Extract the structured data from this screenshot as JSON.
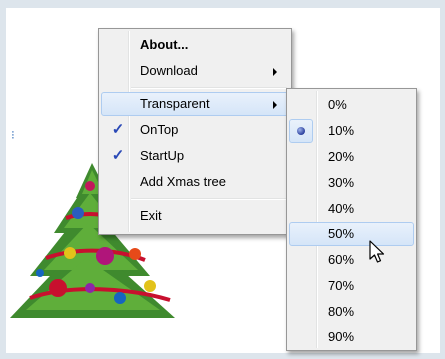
{
  "main_menu": {
    "items": [
      {
        "label": "About...",
        "bold": true
      },
      {
        "label": "Download",
        "submenu": true
      },
      {
        "label": "Transparent",
        "submenu": true,
        "highlighted": true
      },
      {
        "label": "OnTop",
        "checked": true
      },
      {
        "label": "StartUp",
        "checked": true
      },
      {
        "label": "Add Xmas tree"
      },
      {
        "label": "Exit"
      }
    ],
    "check_glyph": "✓"
  },
  "transparency_menu": {
    "items": [
      "0%",
      "10%",
      "20%",
      "30%",
      "40%",
      "50%",
      "60%",
      "70%",
      "80%",
      "90%"
    ],
    "selected": "10%",
    "hovered": "50%"
  },
  "colors": {
    "menu_bg": "#f0f0f0",
    "highlight": "#d5e5f8",
    "highlight_border": "#aeccf0",
    "check": "#2a49b6"
  },
  "icons": [
    "check-icon",
    "submenu-arrow-icon",
    "radio-dot-icon",
    "mouse-cursor-icon",
    "xmas-tree-icon"
  ]
}
